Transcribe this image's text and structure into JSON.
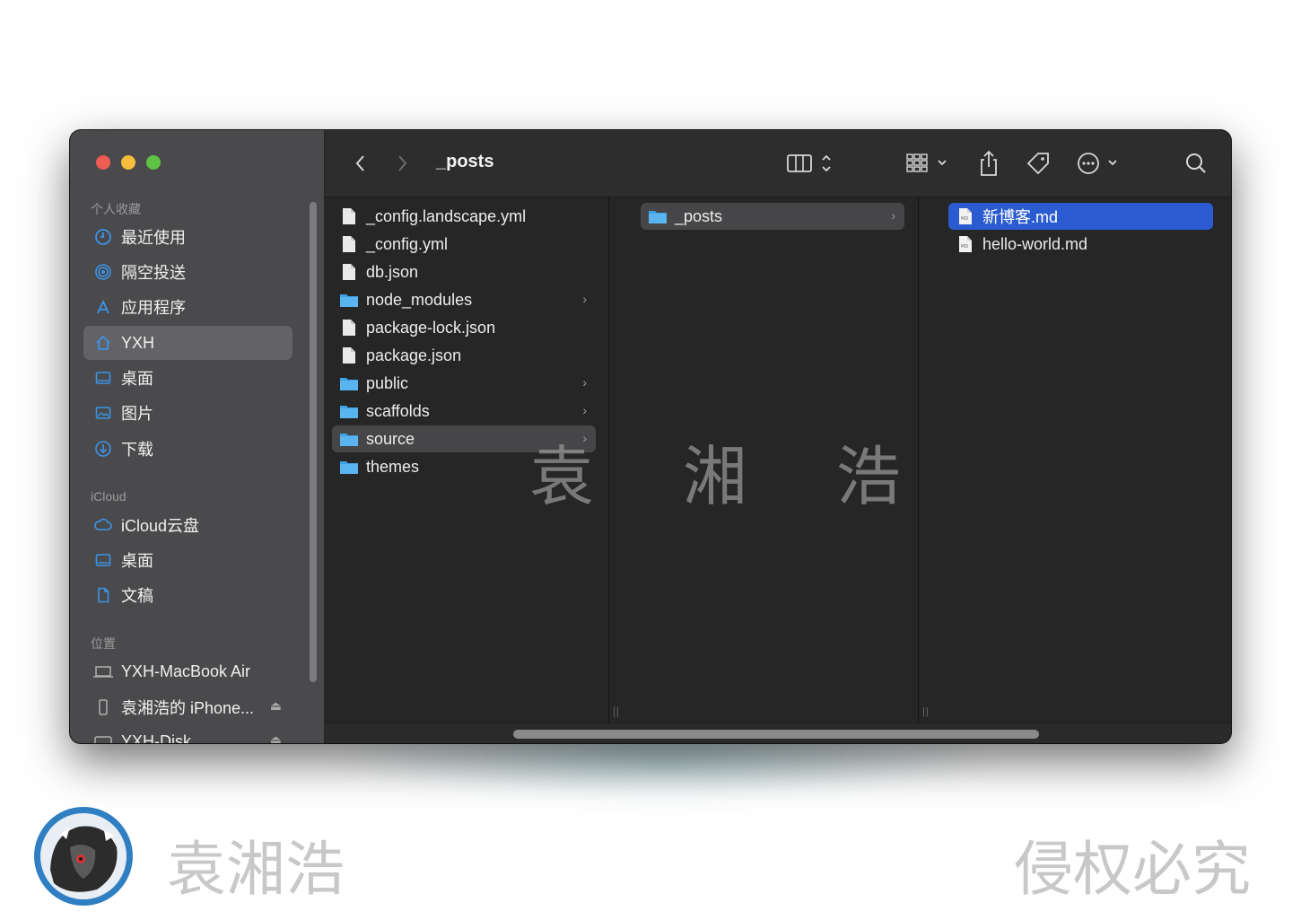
{
  "sidebar": {
    "sections": {
      "favorites": "个人收藏",
      "icloud": "iCloud",
      "locations": "位置"
    },
    "favorites": [
      {
        "label": "最近使用",
        "icon": "clock-icon"
      },
      {
        "label": "隔空投送",
        "icon": "airdrop-icon"
      },
      {
        "label": "应用程序",
        "icon": "applications-icon"
      },
      {
        "label": "YXH",
        "icon": "home-icon",
        "selected": true
      },
      {
        "label": "桌面",
        "icon": "desktop-icon"
      },
      {
        "label": "图片",
        "icon": "pictures-icon"
      },
      {
        "label": "下载",
        "icon": "download-icon"
      }
    ],
    "icloud_items": [
      {
        "label": "iCloud云盘",
        "icon": "cloud-icon"
      },
      {
        "label": "桌面",
        "icon": "desktop-icon"
      },
      {
        "label": "文稿",
        "icon": "document-icon"
      }
    ],
    "locations": [
      {
        "label": "YXH-MacBook Air",
        "icon": "laptop-icon"
      },
      {
        "label": "袁湘浩的 iPhone...",
        "icon": "phone-icon"
      },
      {
        "label": "YXH-Disk",
        "icon": "disk-icon"
      }
    ]
  },
  "toolbar": {
    "title": "_posts"
  },
  "columns": {
    "col1": [
      {
        "name": "_config.landscape.yml",
        "type": "file"
      },
      {
        "name": "_config.yml",
        "type": "file"
      },
      {
        "name": "db.json",
        "type": "file"
      },
      {
        "name": "node_modules",
        "type": "folder"
      },
      {
        "name": "package-lock.json",
        "type": "file"
      },
      {
        "name": "package.json",
        "type": "file"
      },
      {
        "name": "public",
        "type": "folder"
      },
      {
        "name": "scaffolds",
        "type": "folder"
      },
      {
        "name": "source",
        "type": "folder",
        "selected": true
      },
      {
        "name": "themes",
        "type": "folder"
      }
    ],
    "col2": [
      {
        "name": "_posts",
        "type": "folder",
        "selected": true
      }
    ],
    "col3": [
      {
        "name": "新博客.md",
        "type": "md",
        "selected": true
      },
      {
        "name": "hello-world.md",
        "type": "md"
      }
    ]
  },
  "watermark": {
    "center": "袁 湘 浩",
    "name": "袁湘浩",
    "notice": "侵权必究"
  },
  "colors": {
    "selection_blue": "#2b5bd0",
    "folder_blue": "#3ea2e6",
    "sidebar_icon_blue": "#3b94e8"
  }
}
